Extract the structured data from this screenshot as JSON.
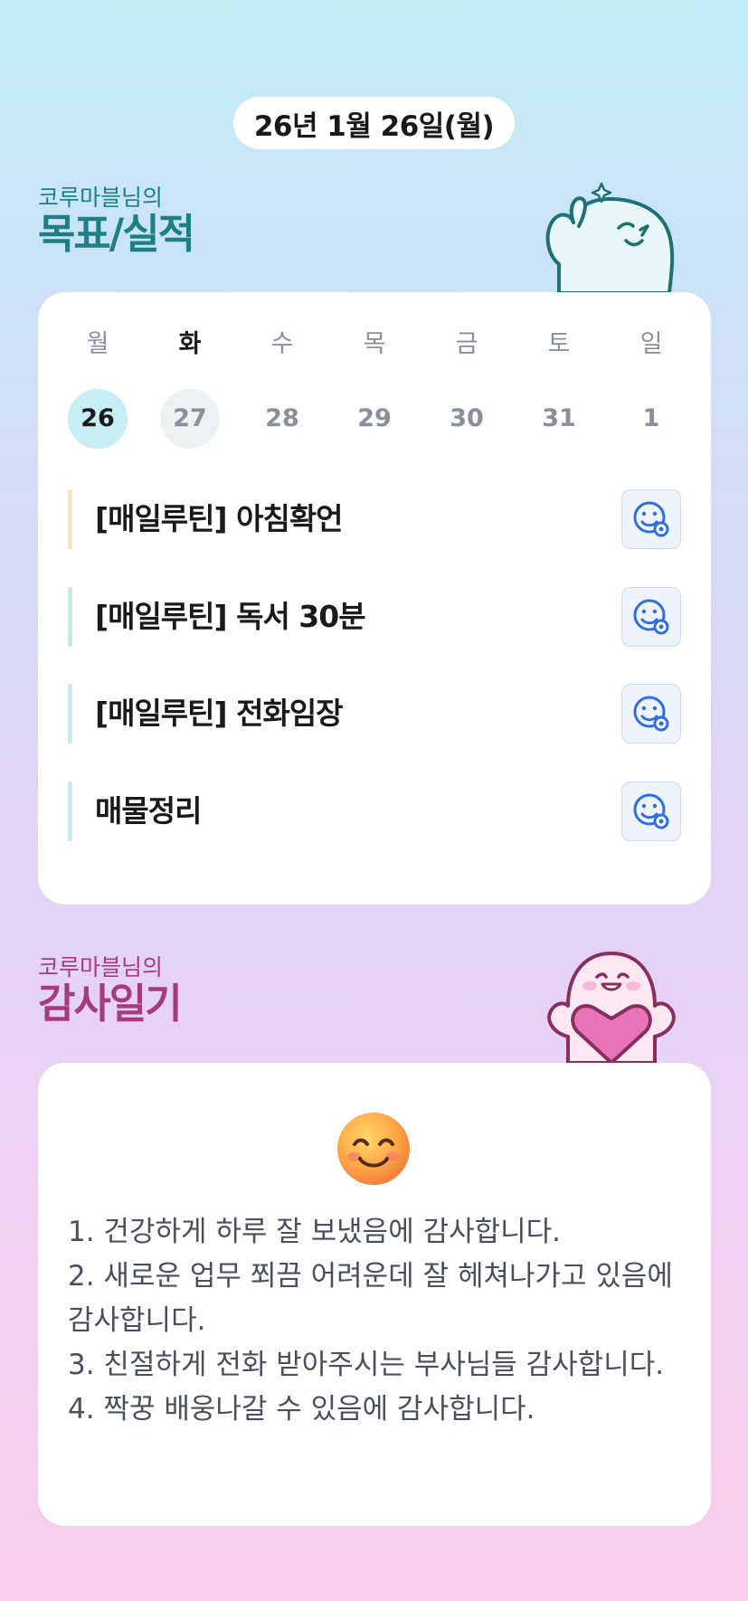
{
  "header": {
    "date": "26년 1월 26일(월)"
  },
  "goals_section": {
    "subtitle": "코루마블님의",
    "title": "목표/실적"
  },
  "week": {
    "weekdays": [
      "월",
      "화",
      "수",
      "목",
      "금",
      "토",
      "일"
    ],
    "dates": [
      "26",
      "27",
      "28",
      "29",
      "30",
      "31",
      "1"
    ],
    "selected_index": 0,
    "today_index": 1
  },
  "goals": [
    {
      "label": "[매일루틴] 아침확언",
      "bar_color": "#fde3b8",
      "icon": "smile-add-icon"
    },
    {
      "label": "[매일루틴] 독서 30분",
      "bar_color": "#bfeee0",
      "icon": "smile-add-icon"
    },
    {
      "label": "[매일루틴] 전화임장",
      "bar_color": "#c2ecf2",
      "icon": "smile-add-icon"
    },
    {
      "label": "매물정리",
      "bar_color": "#c2ecf2",
      "icon": "smile-add-icon"
    }
  ],
  "thanks_section": {
    "subtitle": "코루마블님의",
    "title": "감사일기"
  },
  "diary": {
    "emoji": "smiling-face-emoji",
    "text": "1. 건강하게 하루 잘 보냈음에 감사합니다.\n2. 새로운 업무 쬐끔 어려운데 잘 헤쳐나가고 있음에 감사합니다.\n3. 친절하게 전화 받아주시는 부사님들 감사합니다.\n4. 짝꿍 배웅나갈 수 있음에 감사합니다."
  },
  "colors": {
    "goals_accent": "#1f7f86",
    "thanks_accent": "#a43c7a",
    "icon_blue": "#2f6fe0"
  }
}
